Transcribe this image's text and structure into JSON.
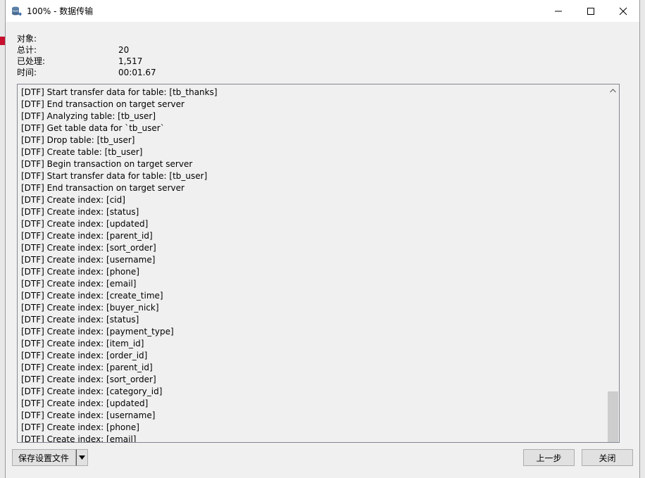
{
  "window": {
    "title": "100% - 数据传输",
    "icon": "database-transfer-icon"
  },
  "info": [
    {
      "label": "对象:",
      "value": ""
    },
    {
      "label": "总计:",
      "value": "20"
    },
    {
      "label": "已处理:",
      "value": "1,517"
    },
    {
      "label": "时间:",
      "value": "00:01.67"
    }
  ],
  "log": [
    "[DTF] Start transfer data for table: [tb_thanks]",
    "[DTF] End transaction on target server",
    "[DTF] Analyzing table: [tb_user]",
    "[DTF] Get table data for `tb_user`",
    "[DTF] Drop table: [tb_user]",
    "[DTF] Create table: [tb_user]",
    "[DTF] Begin transaction on target server",
    "[DTF] Start transfer data for table: [tb_user]",
    "[DTF] End transaction on target server",
    "[DTF] Create index: [cid]",
    "[DTF] Create index: [status]",
    "[DTF] Create index: [updated]",
    "[DTF] Create index: [parent_id]",
    "[DTF] Create index: [sort_order]",
    "[DTF] Create index: [username]",
    "[DTF] Create index: [phone]",
    "[DTF] Create index: [email]",
    "[DTF] Create index: [create_time]",
    "[DTF] Create index: [buyer_nick]",
    "[DTF] Create index: [status]",
    "[DTF] Create index: [payment_type]",
    "[DTF] Create index: [item_id]",
    "[DTF] Create index: [order_id]",
    "[DTF] Create index: [parent_id]",
    "[DTF] Create index: [sort_order]",
    "[DTF] Create index: [category_id]",
    "[DTF] Create index: [updated]",
    "[DTF] Create index: [username]",
    "[DTF] Create index: [phone]",
    "[DTF] Create index: [email]"
  ],
  "buttons": {
    "save_profile": "保存设置文件",
    "back": "上一步",
    "close": "关闭"
  },
  "colors": {
    "window_bg": "#f0f0f0",
    "titlebar_bg": "#ffffff",
    "scroll_thumb": "#cdcdcd"
  }
}
